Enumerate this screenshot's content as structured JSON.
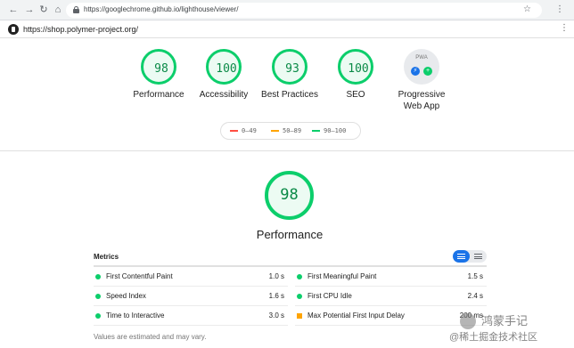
{
  "browser": {
    "url": "https://googlechrome.github.io/lighthouse/viewer/"
  },
  "report": {
    "audited_url": "https://shop.polymer-project.org/"
  },
  "gauges": [
    {
      "score": "98",
      "label": "Performance"
    },
    {
      "score": "100",
      "label": "Accessibility"
    },
    {
      "score": "93",
      "label": "Best Practices"
    },
    {
      "score": "100",
      "label": "SEO"
    }
  ],
  "pwa": {
    "badge_text": "PWA",
    "label_line1": "Progressive",
    "label_line2": "Web App"
  },
  "legend": [
    {
      "range": "0–49",
      "color": "#ff4e42"
    },
    {
      "range": "50–89",
      "color": "#ffa400"
    },
    {
      "range": "90–100",
      "color": "#0cce6b"
    }
  ],
  "performance": {
    "score": "98",
    "title": "Performance"
  },
  "metrics": {
    "title": "Metrics",
    "left": [
      {
        "name": "First Contentful Paint",
        "value": "1.0 s",
        "status": "pass"
      },
      {
        "name": "Speed Index",
        "value": "1.6 s",
        "status": "pass"
      },
      {
        "name": "Time to Interactive",
        "value": "3.0 s",
        "status": "pass"
      }
    ],
    "right": [
      {
        "name": "First Meaningful Paint",
        "value": "1.5 s",
        "status": "pass"
      },
      {
        "name": "First CPU Idle",
        "value": "2.4 s",
        "status": "pass"
      },
      {
        "name": "Max Potential First Input Delay",
        "value": "200 ms",
        "status": "average"
      }
    ],
    "footnote": "Values are estimated and may vary."
  },
  "watermark": {
    "line1": "鸿蒙手记",
    "line2": "@稀土掘金技术社区"
  },
  "colors": {
    "pass": "#0cce6b",
    "average": "#ffa400",
    "fail": "#ff4e42",
    "toggle_active": "#1a73e8"
  }
}
